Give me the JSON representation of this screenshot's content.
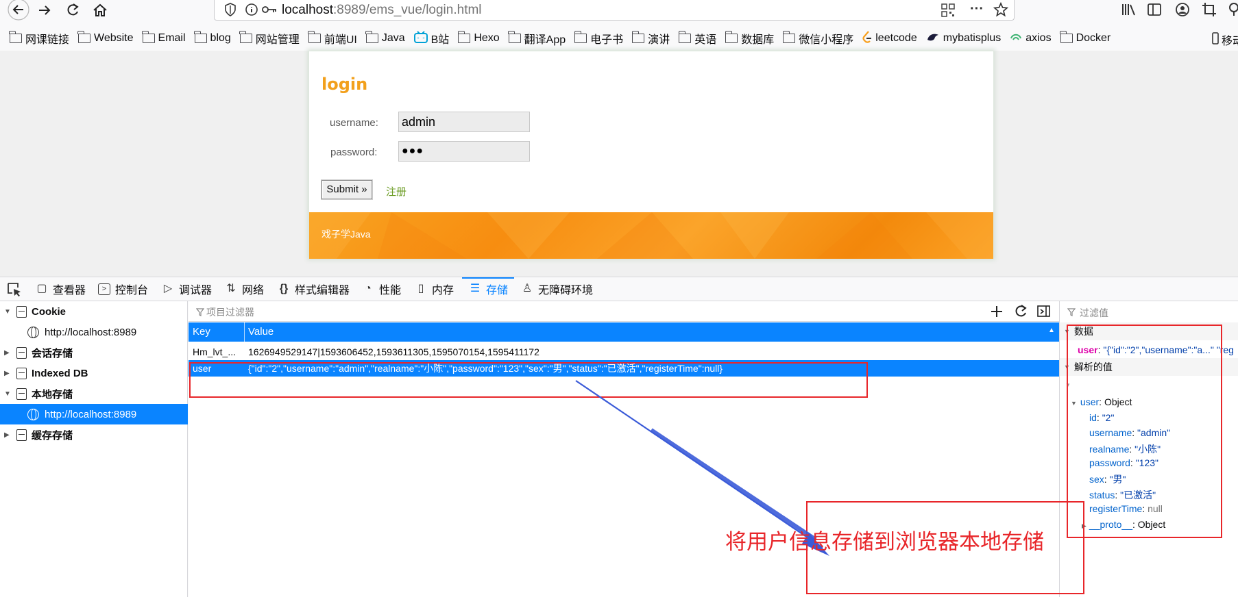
{
  "browser": {
    "url_host": "localhost",
    "url_rest": ":8989/ems_vue/login.html",
    "icons": [
      "back-icon",
      "forward-icon",
      "reload-icon",
      "home-icon",
      "shield-icon",
      "info-icon",
      "key-icon",
      "qr-icon",
      "more-icon",
      "star-icon",
      "library-icon",
      "sidebar-icon",
      "account-icon",
      "crop-icon",
      "extension-icon"
    ]
  },
  "bookmarks": [
    {
      "label": "网课链接",
      "icon": "folder-icon"
    },
    {
      "label": "Website",
      "icon": "folder-icon"
    },
    {
      "label": "Email",
      "icon": "folder-icon"
    },
    {
      "label": "blog",
      "icon": "folder-icon"
    },
    {
      "label": "网站管理",
      "icon": "folder-icon"
    },
    {
      "label": "前端UI",
      "icon": "folder-icon"
    },
    {
      "label": "Java",
      "icon": "folder-icon"
    },
    {
      "label": "B站",
      "icon": "bilibili-icon"
    },
    {
      "label": "Hexo",
      "icon": "folder-icon"
    },
    {
      "label": "翻译App",
      "icon": "folder-icon"
    },
    {
      "label": "电子书",
      "icon": "folder-icon"
    },
    {
      "label": "演讲",
      "icon": "folder-icon"
    },
    {
      "label": "英语",
      "icon": "folder-icon"
    },
    {
      "label": "数据库",
      "icon": "folder-icon"
    },
    {
      "label": "微信小程序",
      "icon": "folder-icon"
    },
    {
      "label": "leetcode",
      "icon": "leetcode-icon"
    },
    {
      "label": "mybatisplus",
      "icon": "mybatisplus-icon"
    },
    {
      "label": "axios",
      "icon": "axios-icon"
    },
    {
      "label": "Docker",
      "icon": "folder-icon"
    },
    {
      "label": "移动",
      "icon": "mobile-icon"
    }
  ],
  "login": {
    "title": "login",
    "username_label": "username:",
    "username_value": "admin",
    "password_label": "password:",
    "password_value": "●●●",
    "submit_label": "Submit »",
    "register_label": "注册",
    "footer_text": "戏子学Java"
  },
  "devtools": {
    "tabs": [
      {
        "label": "查看器",
        "icon": "inspector-icon"
      },
      {
        "label": "控制台",
        "icon": "console-icon"
      },
      {
        "label": "调试器",
        "icon": "debugger-icon"
      },
      {
        "label": "网络",
        "icon": "network-icon"
      },
      {
        "label": "样式编辑器",
        "icon": "style-editor-icon"
      },
      {
        "label": "性能",
        "icon": "performance-icon"
      },
      {
        "label": "内存",
        "icon": "memory-icon"
      },
      {
        "label": "存储",
        "icon": "storage-icon"
      },
      {
        "label": "无障碍环境",
        "icon": "accessibility-icon"
      }
    ],
    "active_tab": "存储"
  },
  "tree": {
    "cookie": "Cookie",
    "cookie_host": "http://localhost:8989",
    "session": "会话存储",
    "indexeddb": "Indexed DB",
    "local": "本地存储",
    "local_host": "http://localhost:8989",
    "cache": "缓存存储"
  },
  "table": {
    "filter_placeholder": "项目过滤器",
    "col_key": "Key",
    "col_value": "Value",
    "rows": [
      {
        "key": "Hm_lvt_...",
        "value": "1626949529147|1593606452,1593611305,1595070154,1595411172"
      },
      {
        "key": "user",
        "value": "{\"id\":\"2\",\"username\":\"admin\",\"realname\":\"小陈\",\"password\":\"123\",\"sex\":\"男\",\"status\":\"已激活\",\"registerTime\":null}"
      }
    ]
  },
  "sidebar": {
    "filter_placeholder": "过滤值",
    "data_header": "数据",
    "data_key": "user",
    "data_value": "\"{\"id\":\"2\",\"username\":\"a...\"",
    "data_tail": "\"reg",
    "parsed_header": "解析的值",
    "object_key": "user",
    "object_type": "Object",
    "fields": [
      {
        "key": "id",
        "value": "\"2\""
      },
      {
        "key": "username",
        "value": "\"admin\""
      },
      {
        "key": "realname",
        "value": "\"小陈\""
      },
      {
        "key": "password",
        "value": "\"123\""
      },
      {
        "key": "sex",
        "value": "\"男\""
      },
      {
        "key": "status",
        "value": "\"已激活\""
      },
      {
        "key": "registerTime",
        "value": "null"
      }
    ],
    "proto_key": "__proto__",
    "proto_value": "Object"
  },
  "annotation": {
    "text": "将用户信息存储到浏览器本地存储",
    "color": "#e8262a",
    "arrow_color": "#3b5bd8"
  }
}
